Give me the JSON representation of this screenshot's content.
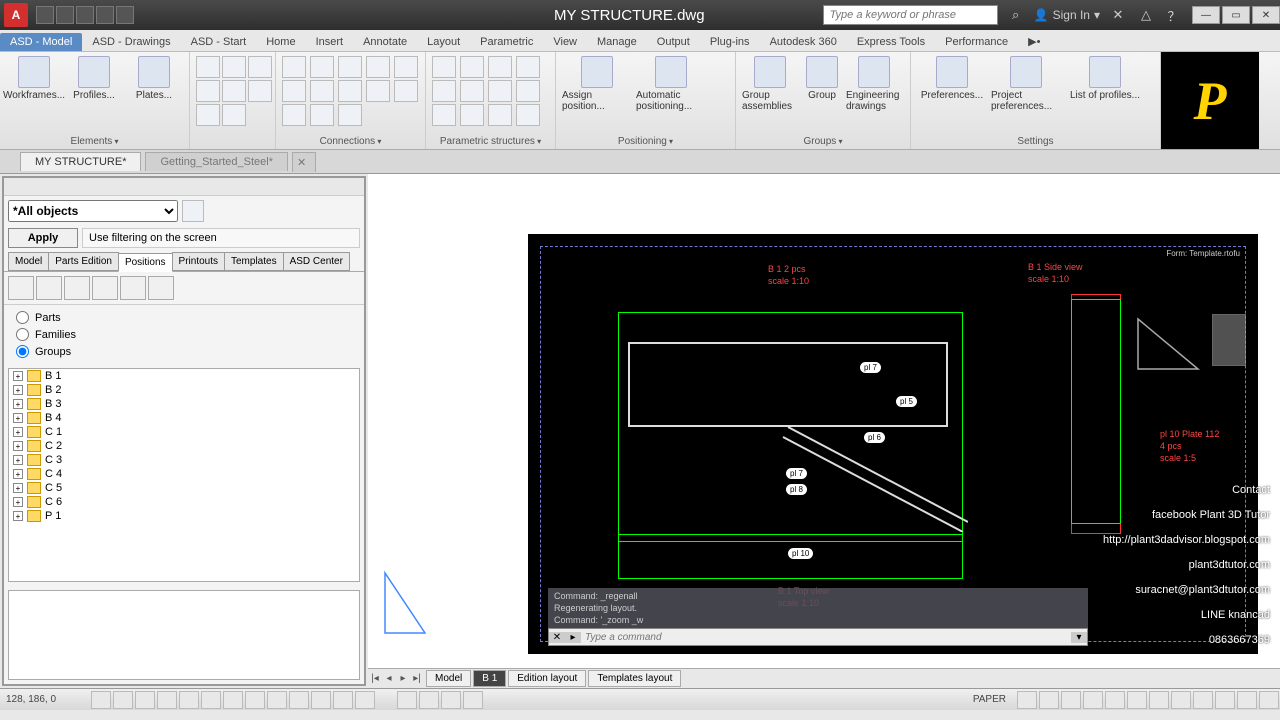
{
  "titlebar": {
    "title": "MY STRUCTURE.dwg",
    "search_placeholder": "Type a keyword or phrase",
    "signin": "Sign In"
  },
  "ribbon_tabs": [
    "ASD - Model",
    "ASD - Drawings",
    "ASD - Start",
    "Home",
    "Insert",
    "Annotate",
    "Layout",
    "Parametric",
    "View",
    "Manage",
    "Output",
    "Plug-ins",
    "Autodesk 360",
    "Express Tools",
    "Performance"
  ],
  "ribbon": {
    "elements": {
      "label": "Elements",
      "btns": [
        "Workframes...",
        "Profiles...",
        "Plates..."
      ]
    },
    "connections": {
      "label": "Connections"
    },
    "parametric": {
      "label": "Parametric structures"
    },
    "positioning": {
      "label": "Positioning",
      "assign": "Assign position...",
      "auto": "Automatic positioning..."
    },
    "groups": {
      "label": "Groups",
      "b1": "Group assemblies",
      "b2": "Group",
      "b3": "Engineering drawings"
    },
    "settings": {
      "label": "Settings",
      "b1": "Preferences...",
      "b2": "Project preferences...",
      "b3": "List of profiles..."
    }
  },
  "doc_tabs": [
    "MY STRUCTURE*",
    "Getting_Started_Steel*"
  ],
  "panel": {
    "filter": "*All objects",
    "apply": "Apply",
    "use_filter": "Use filtering on the screen",
    "sub_tabs": [
      "Model",
      "Parts Edition",
      "Positions",
      "Printouts",
      "Templates",
      "ASD Center"
    ],
    "radios": [
      "Parts",
      "Families",
      "Groups"
    ],
    "radio_selected": "Groups",
    "tree": [
      "B 1",
      "B 2",
      "B 3",
      "B 4",
      "C 1",
      "C 2",
      "C 3",
      "C 4",
      "C 5",
      "C 6",
      "P 1"
    ]
  },
  "layout_tabs": [
    "Model",
    "B 1",
    "Edition layout",
    "Templates layout"
  ],
  "drawing": {
    "t1": "B 1 2 pcs",
    "t2": "scale 1:10",
    "t3": "B 1 Side view",
    "t4": "scale 1:10",
    "t5": "B 1 Top view",
    "t6": "scale 1:10",
    "pl1": "pl 10 Plate 112",
    "pl2": "4 pcs",
    "pl3": "scale 1:5",
    "title_block": "Form: Template.rtofu",
    "c1": "pl 7",
    "c2": "pl 5",
    "c3": "pl 6",
    "c4": "pl 7",
    "c5": "pl 8",
    "c6": "pl 10"
  },
  "cmd": {
    "h1": "Command: _regenall",
    "h2": "Regenerating layout.",
    "h3": "Command:   '_zoom  _w",
    "placeholder": "Type a command"
  },
  "watermark": {
    "w1": "Contact",
    "w2": "facebook Plant 3D Tutor",
    "w3": "http://plant3dadvisor.blogspot.com",
    "w4": "plant3dtutor.com",
    "w5": "suracnet@plant3dtutor.com",
    "w6": "LINE knancad",
    "w7": "0863667369"
  },
  "status": {
    "coords": "128, 186, 0",
    "paper": "PAPER"
  }
}
